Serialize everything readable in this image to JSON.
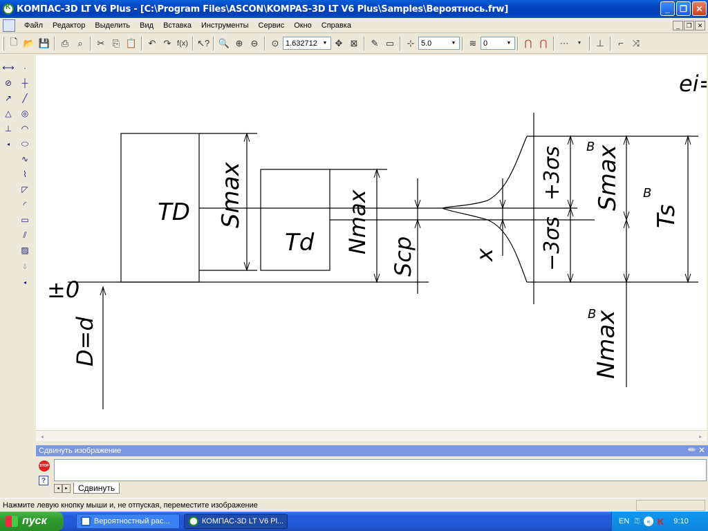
{
  "window": {
    "title": "КОМПАС-3D LT V6 Plus - [C:\\Program Files\\ASCON\\KOMPAS-3D LT V6 Plus\\Samples\\Вероятнось.frw]"
  },
  "menu": [
    "Файл",
    "Редактор",
    "Выделить",
    "Вид",
    "Вставка",
    "Инструменты",
    "Сервис",
    "Окно",
    "Справка"
  ],
  "toolbar": {
    "zoom": "1.632712",
    "step": "5.0",
    "layer": "0"
  },
  "drawing": {
    "label_TD": "TD",
    "label_Td": "Td",
    "label_Smax": "Smax",
    "label_Nmax": "Nmax",
    "label_Scp": "Scp",
    "label_x": "x",
    "label_plus3": "+3σs",
    "label_minus3": "−3σs",
    "label_SmaxB": "Smax",
    "label_TsB": "Ts",
    "label_NmaxB": "Nmax",
    "sup_B": "B",
    "label_zero": "±0",
    "label_Dd": "D=d",
    "label_ei": "ei="
  },
  "panel": {
    "title": "Сдвинуть изображение",
    "tab": "Сдвинуть"
  },
  "status": {
    "hint": "Нажмите левую кнопку мыши и, не отпуская, переместите изображение"
  },
  "taskbar": {
    "start": "пуск",
    "task1": "Вероятностный рас...",
    "task2": "КОМПАС-3D LT V6 Pl...",
    "lang": "EN",
    "time": "9:10"
  }
}
